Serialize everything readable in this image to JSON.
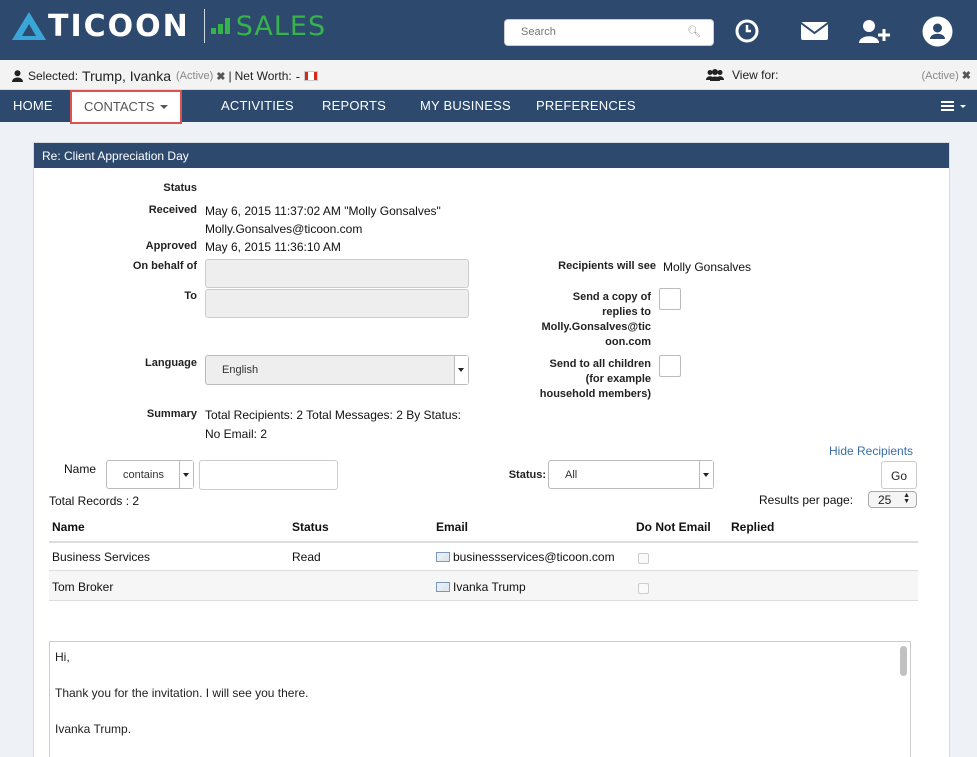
{
  "header": {
    "brand": "TICOON",
    "product": "SALES",
    "search_placeholder": "Search",
    "icons": [
      "clock-icon",
      "mail-icon",
      "add-user-icon",
      "user-icon"
    ]
  },
  "selection": {
    "label": "Selected:",
    "name": "Trump, Ivanka",
    "status": "(Active)",
    "remove": "✖",
    "sep": "|",
    "net_worth_label": "Net Worth:",
    "net_worth_value": "-",
    "view_for_label": "View for:",
    "view_for_status": "(Active)"
  },
  "nav": {
    "home": "HOME",
    "contacts": "CONTACTS",
    "activities": "ACTIVITIES",
    "reports": "REPORTS",
    "my_business": "MY BUSINESS",
    "preferences": "PREFERENCES"
  },
  "panel": {
    "title": "Re: Client Appreciation Day",
    "status_label": "Status",
    "status_value": "",
    "received_label": "Received",
    "received_value_1": "May 6, 2015 11:37:02 AM \"Molly Gonsalves\"",
    "received_value_2": "Molly.Gonsalves@ticoon.com",
    "approved_label": "Approved",
    "approved_value": "May 6, 2015 11:36:10 AM",
    "on_behalf_label": "On behalf of",
    "to_label": "To",
    "language_label": "Language",
    "language_value": "English",
    "summary_label": "Summary",
    "summary_line1": "Total Recipients: 2 Total Messages: 2 By Status:",
    "summary_line2": "No Email: 2",
    "recipients_see_label": "Recipients will see",
    "recipients_see_value": "Molly Gonsalves",
    "send_copy_l1": "Send a copy of",
    "send_copy_l2": "replies to",
    "send_copy_l3": "Molly.Gonsalves@tic",
    "send_copy_l4": "oon.com",
    "send_children_l1": "Send to all children",
    "send_children_l2": "(for example",
    "send_children_l3": "household members)"
  },
  "filters": {
    "hide_recipients": "Hide Recipients",
    "name_label": "Name",
    "name_op": "contains",
    "name_value": "",
    "status_label": "Status:",
    "status_value": "All",
    "go": "Go",
    "total_records": "Total Records : 2",
    "results_per_page_label": "Results per page:",
    "results_per_page_value": "25"
  },
  "table": {
    "headers": [
      "Name",
      "Status",
      "Email",
      "Do Not Email",
      "Replied"
    ],
    "rows": [
      {
        "name": "Business Services",
        "status": "Read",
        "email": "businessservices@ticoon.com"
      },
      {
        "name": "Tom Broker",
        "status": "",
        "email": "Ivanka Trump"
      }
    ]
  },
  "message": {
    "line1": "Hi,",
    "line2": "Thank you for the invitation. I will see you there.",
    "line3": "Ivanka Trump."
  },
  "colors": {
    "header_bg": "#2d4a6e",
    "accent_green": "#36b34a",
    "accent_blue": "#3aa6d8",
    "highlight_red": "#d9534f"
  }
}
